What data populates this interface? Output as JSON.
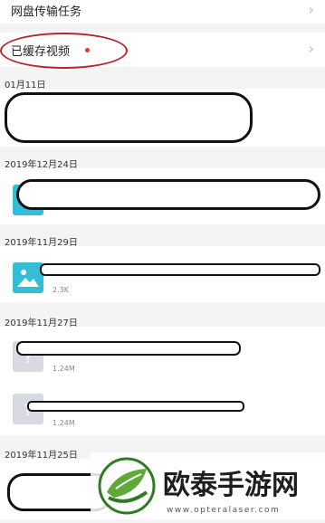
{
  "menu": [
    {
      "label": "网盘传输任务"
    },
    {
      "label": "已缓存视频"
    }
  ],
  "sections": [
    {
      "date": "01月11日",
      "items": []
    },
    {
      "date": "2019年12月24日",
      "items": []
    },
    {
      "date": "2019年11月29日",
      "items": [
        {
          "size": "2.3K"
        }
      ]
    },
    {
      "date": "2019年11月27日",
      "items": [
        {
          "size": "1.24M"
        },
        {
          "size": "1.24M"
        }
      ]
    },
    {
      "date": "2019年11月25日",
      "items": []
    }
  ],
  "watermark": {
    "brand": "欧泰手游网",
    "url": "www.opteralaser.com"
  },
  "colors": {
    "accent_red": "#b6262e",
    "dot_red": "#e23a3a",
    "thumb_image": "#35bcd6",
    "thumb_doc": "#d8dae3",
    "brand_green": "#3d8a2e"
  },
  "icons": [
    "chevron-right-icon",
    "image-file-icon",
    "document-file-icon",
    "leaf-logo-icon"
  ]
}
